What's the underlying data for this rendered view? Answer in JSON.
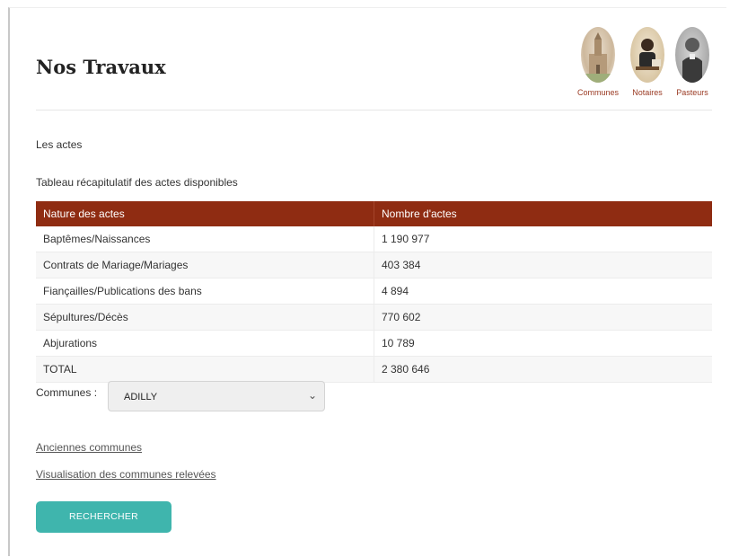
{
  "page": {
    "title": "Nos Travaux"
  },
  "portraits": [
    {
      "label": "Communes"
    },
    {
      "label": "Notaires"
    },
    {
      "label": "Pasteurs"
    }
  ],
  "sections": {
    "actes_label": "Les actes",
    "table_label": "Tableau récapitulatif des actes disponibles"
  },
  "table": {
    "headers": [
      "Nature des actes",
      "Nombre d'actes"
    ],
    "rows": [
      [
        "Baptêmes/Naissances",
        "1 190 977"
      ],
      [
        "Contrats de Mariage/Mariages",
        "403 384"
      ],
      [
        "Fiançailles/Publications des bans",
        "4 894"
      ],
      [
        "Sépultures/Décès",
        "770 602"
      ],
      [
        "Abjurations",
        "10 789"
      ],
      [
        "TOTAL",
        "2 380 646"
      ]
    ]
  },
  "communes": {
    "label": "Communes :",
    "selected": "ADILLY"
  },
  "links": {
    "anciennes": "Anciennes communes",
    "visualisation": "Visualisation des communes relevées"
  },
  "button": {
    "search_label": "RECHERCHER"
  },
  "colors": {
    "header_bg": "#8f2c12",
    "button_bg": "#3fb5ad",
    "caption": "#9a3a23"
  }
}
